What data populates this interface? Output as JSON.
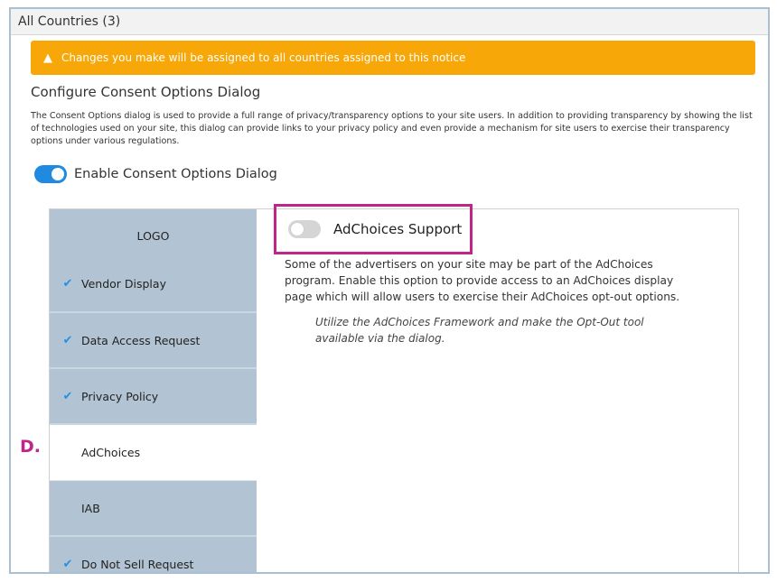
{
  "header": {
    "title": "All Countries (3)"
  },
  "warning": {
    "icon": "warning-icon",
    "text": "Changes you make will be assigned to all countries assigned to this notice",
    "color": "#f7a707"
  },
  "section": {
    "title": "Configure Consent Options Dialog",
    "description": "The Consent Options dialog is used to provide a full range of privacy/transparency options to your site users. In addition to providing transparency by showing the list of technologies used on your site, this dialog can provide links to your privacy policy and even provide a mechanism for site users to exercise their transparency options under various regulations."
  },
  "enable_toggle": {
    "label": "Enable Consent Options Dialog",
    "state": "on",
    "color": "#1f8ae0"
  },
  "nav": {
    "items": [
      {
        "label": "LOGO",
        "checked": false,
        "active": false
      },
      {
        "label": "Vendor Display",
        "checked": true,
        "active": false
      },
      {
        "label": "Data Access Request",
        "checked": true,
        "active": false
      },
      {
        "label": "Privacy Policy",
        "checked": true,
        "active": false
      },
      {
        "label": "AdChoices",
        "checked": false,
        "active": true
      },
      {
        "label": "IAB",
        "checked": false,
        "active": false
      },
      {
        "label": "Do Not Sell Request",
        "checked": true,
        "active": false
      }
    ]
  },
  "adchoices": {
    "label": "AdChoices Support",
    "state": "off",
    "description": "Some of the advertisers on your site may be part of the AdChoices program. Enable this option to provide access to an AdChoices display page which will allow users to exercise their AdChoices opt-out options.",
    "note": "Utilize the AdChoices Framework and make the Opt-Out tool available via the dialog."
  },
  "annotation": {
    "marker": "D.",
    "color": "#c0258a"
  }
}
